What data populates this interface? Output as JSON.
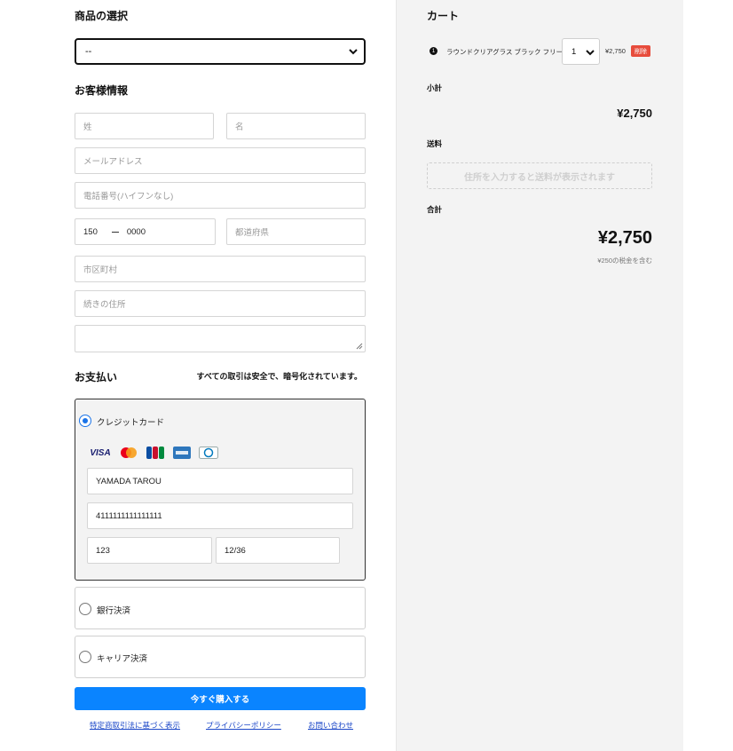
{
  "form": {
    "product_heading": "商品の選択",
    "product_select_value": "--",
    "customer_heading": "お客様情報",
    "last_name_placeholder": "姓",
    "first_name_placeholder": "名",
    "email_placeholder": "メールアドレス",
    "phone_placeholder": "電話番号(ハイフンなし)",
    "zip1": "150",
    "zip2": "0000",
    "prefecture_placeholder": "都道府県",
    "city_placeholder": "市区町村",
    "address_placeholder": "続きの住所",
    "payment_heading": "お支払い",
    "secure_note": "すべての取引は安全で、暗号化されています。",
    "credit_label": "クレジットカード",
    "card_brands": [
      "visa-icon",
      "mastercard-icon",
      "jcb-icon",
      "amex-icon",
      "diners-icon"
    ],
    "card_brand_visa_text": "VISA",
    "card_holder": "YAMADA TAROU",
    "card_number": "4111111111111111",
    "card_cvc": "123",
    "card_expiry": "12/36",
    "bank_label": "銀行決済",
    "carrier_label": "キャリア決済",
    "buy_button": "今すぐ購入する",
    "links": [
      "特定商取引法に基づく表示",
      "プライバシーポリシー",
      "お問い合わせ"
    ]
  },
  "cart": {
    "title": "カート",
    "item": {
      "badge": "1",
      "name": "ラウンドクリアグラス ブラック フリー",
      "qty": "1",
      "price": "¥2,750",
      "remove_label": "削除"
    },
    "subtotal_label": "小計",
    "subtotal": "¥2,750",
    "shipping_label": "送料",
    "shipping_placeholder": "住所を入力すると送料が表示されます",
    "total_label": "合計",
    "total": "¥2,750",
    "tax_note": "¥250の税金を含む"
  },
  "colors": {
    "buy_button": "#0a84ff",
    "remove_badge": "#e74c3c",
    "link": "#1a46c8",
    "cart_bg": "#f3f3f3"
  }
}
